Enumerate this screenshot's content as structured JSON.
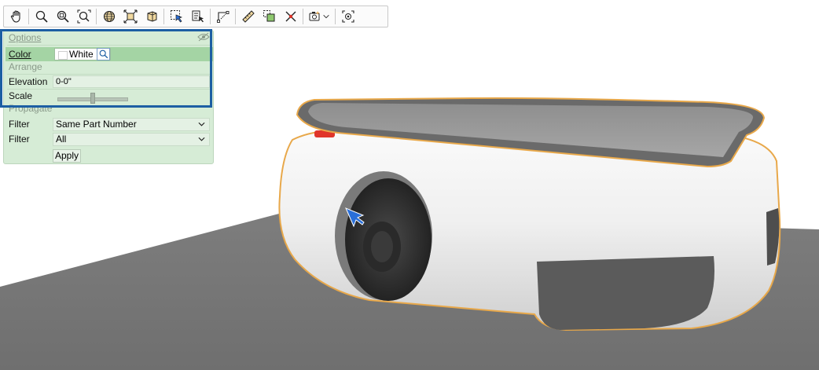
{
  "panel": {
    "options_header": "Options",
    "color_label": "Color",
    "color_value": "White",
    "arrange_header": "Arrange",
    "elevation_label": "Elevation",
    "elevation_value": "0-0\"",
    "scale_label": "Scale",
    "scale_slider_fraction": 0.5,
    "propagate_header": "Propagate",
    "filter1_label": "Filter",
    "filter1_value": "Same Part Number",
    "filter2_label": "Filter",
    "filter2_value": "All",
    "apply_label": "Apply"
  },
  "toolbar": {
    "icons": [
      "pan-hand-icon",
      "zoom-icon",
      "zoom-window-icon",
      "zoom-extents-icon",
      "orbit-globe-icon",
      "fit-all-icon",
      "box-view-icon",
      "select-icon",
      "select-list-icon",
      "measure-points-icon",
      "ruler-icon",
      "copy-select-icon",
      "delete-x-icon",
      "camera-icon",
      "focus-target-icon"
    ]
  },
  "colors": {
    "panel_bg": "#d6ecd6",
    "selection_highlight": "#1d5fa3",
    "object_outline": "#e8a84a",
    "floor": "#7a7a7a"
  }
}
